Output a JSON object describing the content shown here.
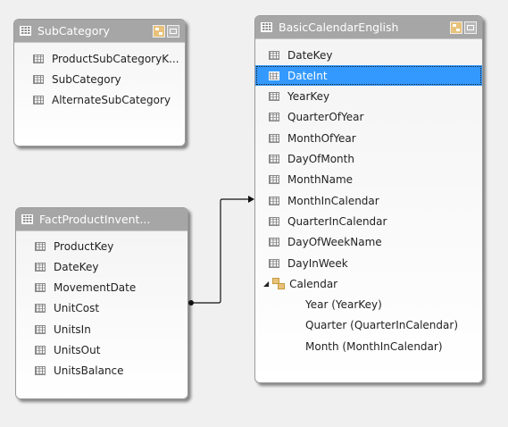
{
  "tables": {
    "subcategory": {
      "title": "SubCategory",
      "fields": [
        "ProductSubCategoryK...",
        "SubCategory",
        "AlternateSubCategory"
      ]
    },
    "calendar": {
      "title": "BasicCalendarEnglish",
      "fields": [
        "DateKey",
        "DateInt",
        "YearKey",
        "QuarterOfYear",
        "MonthOfYear",
        "DayOfMonth",
        "MonthName",
        "MonthInCalendar",
        "QuarterInCalendar",
        "DayOfWeekName",
        "DayInWeek"
      ],
      "selected_field": "DateInt",
      "hierarchy": {
        "name": "Calendar",
        "levels": [
          "Year (YearKey)",
          "Quarter (QuarterInCalendar)",
          "Month (MonthInCalendar)"
        ]
      }
    },
    "fact": {
      "title": "FactProductInvent...",
      "fields": [
        "ProductKey",
        "DateKey",
        "MovementDate",
        "UnitCost",
        "UnitsIn",
        "UnitsOut",
        "UnitsBalance"
      ]
    }
  },
  "relationships": [
    {
      "from": "FactProductInvent...",
      "to": "BasicCalendarEnglish"
    }
  ],
  "colors": {
    "header": "#a6a6a6",
    "selection": "#3399ff",
    "background": "#f0f0f0"
  }
}
